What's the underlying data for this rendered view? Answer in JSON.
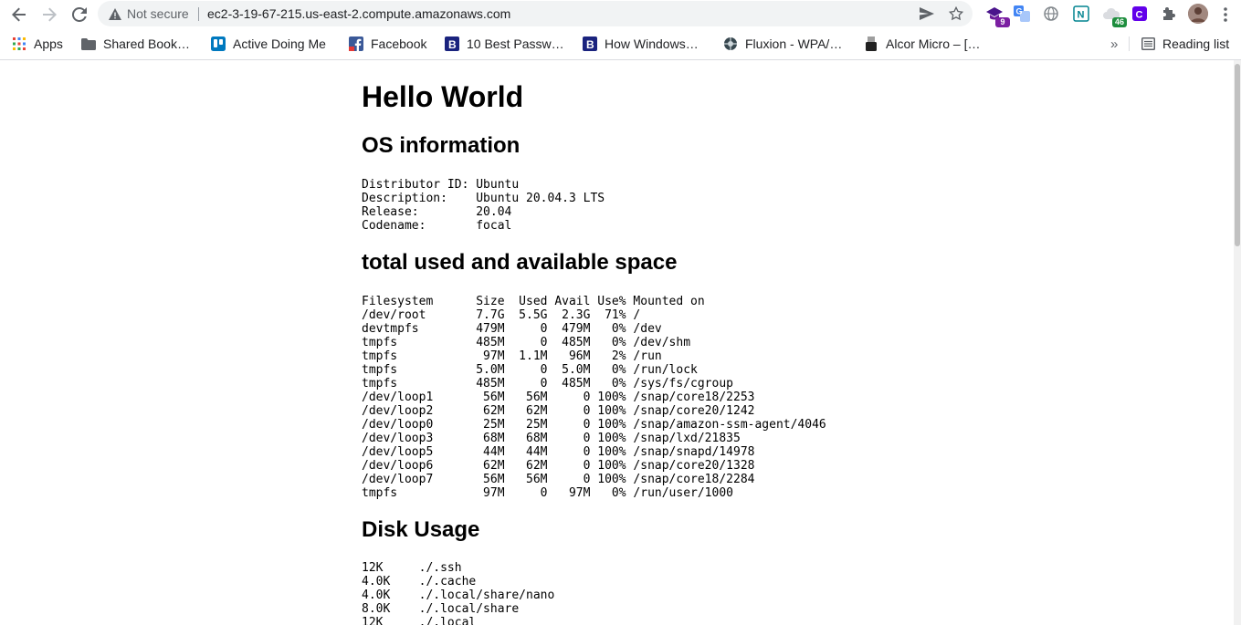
{
  "browser": {
    "security_label": "Not secure",
    "url": "ec2-3-19-67-215.us-east-2.compute.amazonaws.com",
    "extensions": [
      {
        "icon": "graduation-cap-icon",
        "badge": "9",
        "badge_color": "#7b1fa2"
      },
      {
        "icon": "translate-icon"
      },
      {
        "icon": "globe-icon"
      },
      {
        "icon": "n-logo-icon"
      },
      {
        "icon": "cloud-icon",
        "badge": "46",
        "badge_color": "#1e8e3e"
      },
      {
        "icon": "c-logo-icon"
      },
      {
        "icon": "puzzle-icon"
      }
    ]
  },
  "bookmarks": {
    "items": [
      {
        "label": "Apps",
        "icon": "apps-grid-icon"
      },
      {
        "label": "Shared Book…",
        "icon": "folder-icon"
      },
      {
        "label": "Active Doing Me",
        "icon": "trello-icon"
      },
      {
        "label": "Facebook",
        "icon": "facebook-icon"
      },
      {
        "label": "10 Best Passw…",
        "icon": "b-logo-icon"
      },
      {
        "label": "How Windows…",
        "icon": "b-logo-icon"
      },
      {
        "label": "Fluxion - WPA/…",
        "icon": "spider-icon"
      },
      {
        "label": "Alcor Micro – […",
        "icon": "usb-icon"
      }
    ],
    "overflow": "»",
    "reading_list": "Reading list"
  },
  "page": {
    "title": "Hello World",
    "os_heading": "OS information",
    "os_info": "Distributor ID: Ubuntu\nDescription:    Ubuntu 20.04.3 LTS\nRelease:        20.04\nCodename:       focal",
    "space_heading": "total used and available space",
    "df_output": "Filesystem      Size  Used Avail Use% Mounted on\n/dev/root       7.7G  5.5G  2.3G  71% /\ndevtmpfs        479M     0  479M   0% /dev\ntmpfs           485M     0  485M   0% /dev/shm\ntmpfs            97M  1.1M   96M   2% /run\ntmpfs           5.0M     0  5.0M   0% /run/lock\ntmpfs           485M     0  485M   0% /sys/fs/cgroup\n/dev/loop1       56M   56M     0 100% /snap/core18/2253\n/dev/loop2       62M   62M     0 100% /snap/core20/1242\n/dev/loop0       25M   25M     0 100% /snap/amazon-ssm-agent/4046\n/dev/loop3       68M   68M     0 100% /snap/lxd/21835\n/dev/loop5       44M   44M     0 100% /snap/snapd/14978\n/dev/loop6       62M   62M     0 100% /snap/core20/1328\n/dev/loop7       56M   56M     0 100% /snap/core18/2284\ntmpfs            97M     0   97M   0% /run/user/1000",
    "disk_heading": "Disk Usage",
    "du_output": "12K     ./.ssh\n4.0K    ./.cache\n4.0K    ./.local/share/nano\n8.0K    ./.local/share\n12K     ./.local"
  }
}
